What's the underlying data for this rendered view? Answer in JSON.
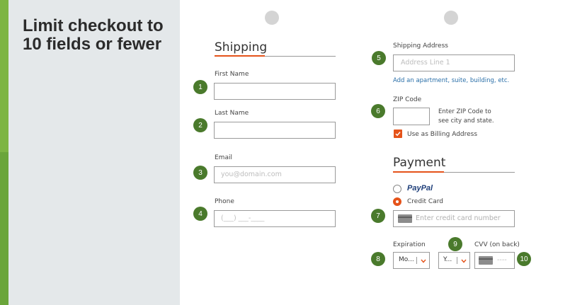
{
  "slide": {
    "title": "Limit checkout to 10 fields or fewer",
    "accent_color": "#6aa53a",
    "brand_color": "#e5531a",
    "badge_color": "#4a7a2c"
  },
  "shipping": {
    "heading": "Shipping",
    "first_name_label": "First Name",
    "last_name_label": "Last Name",
    "email_label": "Email",
    "email_placeholder": "you@domain.com",
    "phone_label": "Phone",
    "phone_placeholder": "(___) ___-____",
    "address_label": "Shipping Address",
    "address_placeholder": "Address Line 1",
    "address_more_link": "Add an apartment, suite, building, etc.",
    "zip_label": "ZIP Code",
    "zip_hint": "Enter ZIP Code to see city and state.",
    "billing_checkbox_label": "Use as Billing Address",
    "billing_checked": true
  },
  "payment": {
    "heading": "Payment",
    "paypal_label": "PayPal",
    "credit_card_label": "Credit Card",
    "selected_method": "Credit Card",
    "card_placeholder": "Enter credit card number",
    "expiration_label": "Expiration",
    "month_value": "Mo...",
    "year_value": "Y...",
    "cvv_label": "CVV (on back)",
    "cvv_placeholder": "----"
  },
  "badges": [
    "1",
    "2",
    "3",
    "4",
    "5",
    "6",
    "7",
    "8",
    "9",
    "10"
  ]
}
